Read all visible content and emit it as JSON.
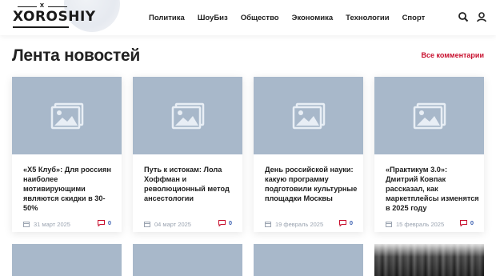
{
  "header": {
    "logo_top": "X",
    "logo_word": "XOROSHIY",
    "nav": [
      "Политика",
      "ШоуБиз",
      "Общество",
      "Экономика",
      "Технологии",
      "Спорт"
    ]
  },
  "page": {
    "title": "Лента новостей",
    "all_comments": "Все комментарии"
  },
  "cards": [
    {
      "title": "«Х5 Клуб»: Для россиян наиболее мотивирующими являются скидки в 30-50%",
      "date": "31 март 2025",
      "comments": "0"
    },
    {
      "title": "Путь к истокам: Лола Хоффман и революционный метод ансесто­логии",
      "date": "04 март 2025",
      "comments": "0"
    },
    {
      "title": "День российской науки: какую программу подготовили культурные площадки Москвы",
      "date": "19 февраль 2025",
      "comments": "0"
    },
    {
      "title": "«Практикум 3.0»: Дмитрий Ковпак рассказал, как маркетплейсы изменятся в 2025 году",
      "date": "15 февраль 2025",
      "comments": "0"
    }
  ],
  "colors": {
    "accent": "#c8102e",
    "placeholder": "#a8b8ca",
    "comment": "#3b5fb0"
  },
  "icons": [
    "search-icon",
    "user-icon",
    "image-placeholder-icon",
    "calendar-icon",
    "comment-icon"
  ]
}
